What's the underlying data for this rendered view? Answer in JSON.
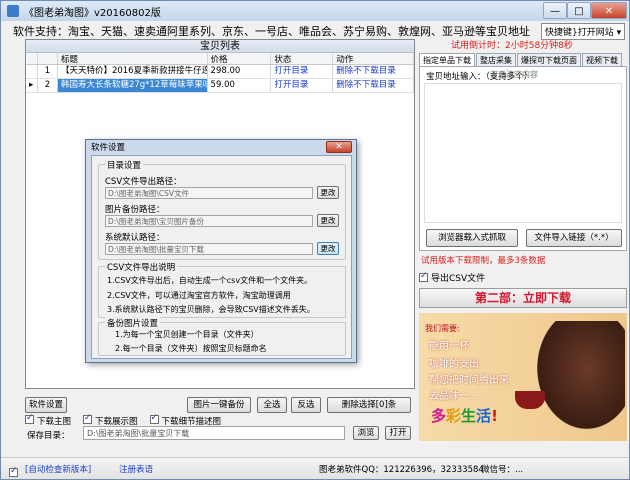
{
  "window": {
    "title": "《图老弟淘图》v20160802版",
    "min_glyph": "—",
    "max_glyph": "□",
    "close_glyph": "✕"
  },
  "support_text": "软件支持：淘宝、天猫、速卖通阿里系列、京东、一号店、唯品会、苏宁易购、敦煌网、亚马逊等宝贝地址",
  "quick_open": "快捷键}打开网站 ▾",
  "list": {
    "title": "宝贝列表",
    "headers": [
      "标题",
      "价格",
      "状态",
      "动作"
    ],
    "rows": [
      {
        "num": "1",
        "title": "【天天特价】2016夏季新款拼接牛仔连衣...",
        "price": "298.00",
        "status": "打开目录",
        "action": "删除不下载目录"
      },
      {
        "num": "2",
        "title": "韩国寿大长条软糖27g*12草莓味苹果味组...",
        "price": "59.00",
        "status": "打开目录",
        "action": "删除不下载目录"
      }
    ]
  },
  "right": {
    "countdown": "试用倒计时：2小时58分钟8秒",
    "tabs": [
      "指定单品下载",
      "整店采集",
      "爆探可下载页面",
      "视频下载"
    ],
    "addr_label": "宝贝地址输入：（支持多个）",
    "addr_placeholder": "双击清空内容",
    "browser_import": "浏览器载入式抓取",
    "file_import": "文件导入链接（*.*）",
    "trial_hint": "试用版本下载限制，最多3条数据",
    "export_csv": "导出CSV文件",
    "step2": "第二部：立即下载"
  },
  "ad": {
    "head": "我们需要:",
    "lines": [
      "能用一杯",
      "咖啡的支出",
      "帮您把时间腾出来",
      "去品味一..."
    ],
    "slogan": [
      "多",
      "彩",
      "生",
      "活",
      "!"
    ],
    "slogan_colors": [
      "#d21a8c",
      "#e29a10",
      "#1d9a2b",
      "#1a64d2",
      "#d21a1a"
    ]
  },
  "bottom": {
    "settings": "软件设置",
    "backup": "图片一键备份",
    "select_all": "全选",
    "invert": "反选",
    "delete_selected": "删除选择[0]条",
    "check_main": "下载主图",
    "check_show": "下载展示图",
    "check_detail": "下载细节描述图",
    "save_label": "保存目录：",
    "save_path": "D:\\图老弟淘图\\批量宝贝下载",
    "browse": "浏览",
    "open": "打开"
  },
  "status": {
    "auto_update": "[自动检查新版本]",
    "register": "注册表语",
    "qq": "图老弟软件QQ：121226396，32333584",
    "wechat": "微信号：..."
  },
  "dialog": {
    "title": "软件设置",
    "close_glyph": "✕",
    "dir_group": "目录设置",
    "csv_label": "CSV文件导出路径：",
    "csv_path": "D:\\图老弟淘图\\CSV文件",
    "img_label": "图片备份路径：",
    "img_path": "D:\\图老弟淘图\\宝贝图片备份",
    "default_label": "系统默认路径：",
    "default_path": "D:\\图老弟淘图\\批量宝贝下载",
    "change": "更改",
    "csv_group": "CSV文件导出说明",
    "csv_lines": [
      "1.CSV文件导出后，自动生成一个csv文件和一个文件夹。",
      "2.CSV文件，可以通过淘宝官方软件，淘宝助理调用",
      "3.系统默认路径下的宝贝删除，会导致CSV描述文件丢失。"
    ],
    "backup_group": "备份图片设置",
    "backup_lines": [
      "1.为每一个宝贝创建一个目录（文件夹）",
      "2.每一个目录（文件夹）按照宝贝标题命名"
    ]
  }
}
